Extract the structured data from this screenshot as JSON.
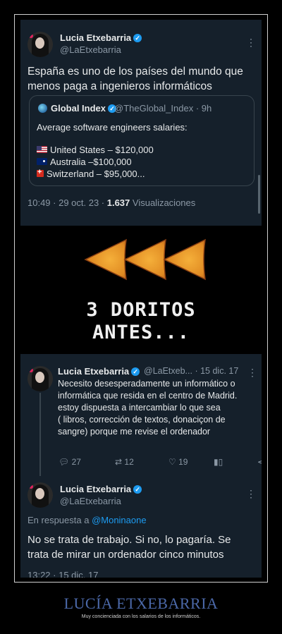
{
  "tweet1": {
    "author": "Lucia Etxebarria",
    "handle": "@LaEtxebarria",
    "body_line1": "España es uno de los países del mundo que",
    "body_line2": "menos paga a ingenieros informáticos",
    "quote": {
      "author": "Global Index",
      "handle_time": "@TheGlobal_Index · 9h",
      "intro": "Average software engineers salaries:",
      "rows": [
        {
          "flag": "us",
          "text": "United States – $120,000"
        },
        {
          "flag": "au",
          "text": "Australia –$100,000"
        },
        {
          "flag": "ch",
          "text": "Switzerland – $95,000..."
        }
      ]
    },
    "meta_time": "10:49 · 29 oct. 23 · ",
    "views_count": "1.637",
    "views_label": " Visualizaciones"
  },
  "meme_panel": {
    "line1": "3 DORITOS",
    "line2": "ANTES..."
  },
  "tweet2": {
    "author": "Lucia Etxebarria",
    "handle_time": "@LaEtxeb... · 15 dic. 17",
    "body_lines": [
      "Necesito desesperadamente un informático o",
      "informática que resida en el centro de Madrid.",
      "estoy dispuesta a intercambiar lo que sea",
      "( libros, corrección de textos, donaciçon de",
      "sangre) porque me revise el ordenador"
    ],
    "replies": "27",
    "retweets": "12",
    "likes": "19"
  },
  "tweet3": {
    "author": "Lucia Etxebarria",
    "handle": "@LaEtxebarria",
    "reply_prefix": "En respuesta a ",
    "reply_to": "@Moninaone",
    "body_line1": "No se trata de trabajo. Si no, lo pagaría. Se",
    "body_line2": "trata de mirar un ordenador cinco minutos",
    "meta": "13:22 · 15 dic. 17"
  },
  "footer": {
    "title": "LUCÍA ETXEBARRIA",
    "subtitle": "Muy concienciada con los salarios de los informáticos."
  },
  "colors": {
    "tweet_bg": "#15202b",
    "accent_blue": "#1d9bf0",
    "title_blue": "#4b68a8",
    "dorito_orange": "#e8952a"
  },
  "icons": [
    "verified-badge-icon",
    "more-options-icon",
    "reply-icon",
    "retweet-icon",
    "like-icon",
    "analytics-icon",
    "share-icon",
    "dorito-arrow-icon"
  ]
}
